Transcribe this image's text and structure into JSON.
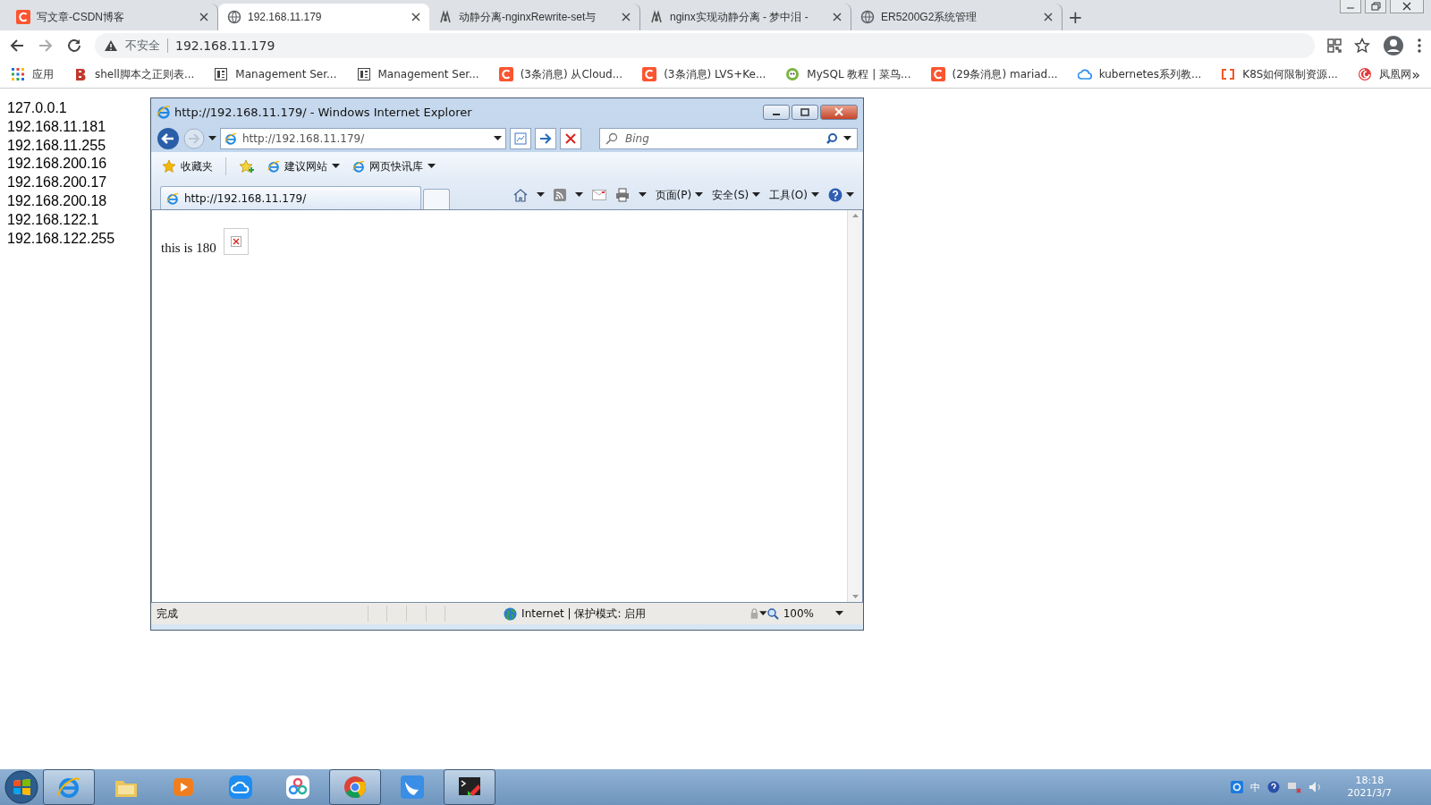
{
  "browser": {
    "tabs": [
      {
        "title": "写文章-CSDN博客",
        "kind": "csdn",
        "selected": false
      },
      {
        "title": "192.168.11.179",
        "kind": "globe",
        "selected": true
      },
      {
        "title": "动静分离-nginxRewrite-set与",
        "kind": "spider",
        "selected": false
      },
      {
        "title": "nginx实现动静分离 - 梦中泪 -",
        "kind": "spider",
        "selected": false
      },
      {
        "title": "ER5200G2系统管理",
        "kind": "globe",
        "selected": false
      }
    ],
    "new_tab": "+",
    "security": "不安全",
    "url": "192.168.11.179",
    "bookmarks": [
      {
        "label": "应用",
        "kind": "apps"
      },
      {
        "label": "shell脚本之正则表...",
        "kind": "shell"
      },
      {
        "label": "Management Ser...",
        "kind": "doc"
      },
      {
        "label": "Management Ser...",
        "kind": "doc"
      },
      {
        "label": "(3条消息) 从Cloud...",
        "kind": "csdn"
      },
      {
        "label": "(3条消息) LVS+Ke...",
        "kind": "csdn"
      },
      {
        "label": "MySQL 教程 | 菜鸟...",
        "kind": "runoob"
      },
      {
        "label": "(29条消息) mariad...",
        "kind": "csdn"
      },
      {
        "label": "kubernetes系列教...",
        "kind": "cloud"
      },
      {
        "label": "K8S如何限制资源...",
        "kind": "bracket"
      },
      {
        "label": "凤凰网",
        "kind": "swirl"
      }
    ],
    "more": "»"
  },
  "page": {
    "addresses": [
      "127.0.0.1",
      "192.168.11.181",
      "192.168.11.255",
      "192.168.200.16",
      "192.168.200.17",
      "192.168.200.18",
      "192.168.122.1",
      "192.168.122.255"
    ]
  },
  "ie_window": {
    "title": "http://192.168.11.179/ - Windows Internet Explorer",
    "address": "http://192.168.11.179/",
    "search_placeholder": "Bing",
    "favorites": "收藏夹",
    "links": [
      "建议网站",
      "网页快讯库"
    ],
    "tab": "http://192.168.11.179/",
    "commands": [
      "页面(P)",
      "安全(S)",
      "工具(O)"
    ],
    "content_text": "this is 180",
    "status": "完成",
    "zone": "Internet | 保护模式: 启用",
    "zoom": "100%"
  },
  "taskbar": {
    "apps": [
      {
        "kind": "ie",
        "running": true
      },
      {
        "kind": "folder",
        "running": false
      },
      {
        "kind": "player",
        "running": false
      },
      {
        "kind": "cloud",
        "running": false
      },
      {
        "kind": "flower",
        "running": false
      },
      {
        "kind": "chrome",
        "running": true
      },
      {
        "kind": "bird",
        "running": false
      },
      {
        "kind": "terminal",
        "running": true
      }
    ],
    "ime": "中",
    "time": "18:18",
    "date": "2021/3/7"
  }
}
